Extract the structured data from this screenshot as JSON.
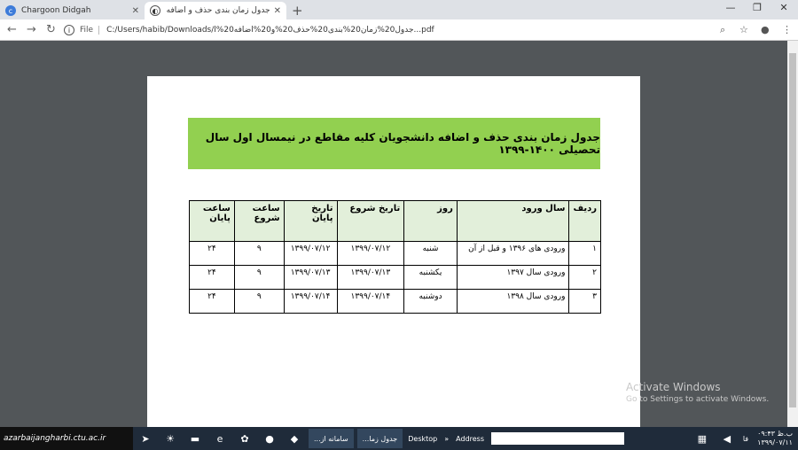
{
  "browser": {
    "tabs": [
      {
        "title": "Chargoon Didgah",
        "icon": "chargoon-icon"
      },
      {
        "title": "جدول زمان بندی حذف و اضافه ...pdf",
        "icon": "globe-icon"
      }
    ],
    "close_glyph": "✕",
    "new_tab_glyph": "+",
    "window_controls": {
      "minimize": "—",
      "maximize": "❐",
      "close": "✕"
    },
    "nav": {
      "back": "←",
      "forward": "→",
      "reload": "↻"
    },
    "address": {
      "scheme": "File",
      "url": "C:/Users/habib/Downloads/جدول20%زمان20%بندی20%حذف20%و20%اضافه20%ا...pdf"
    },
    "toolbar_icons": {
      "zoom": "⌕",
      "star": "☆",
      "account": "●",
      "menu": "⋮"
    }
  },
  "document": {
    "heading": "جدول زمان بندی حذف و اضافه دانشجویان کلیه مقاطع در نیمسال اول سال تحصیلی ۱۴۰۰-۱۳۹۹",
    "columns": [
      "ردیف",
      "سال ورود",
      "روز",
      "تاریخ شروع",
      "تاریخ پایان",
      "ساعت شروع",
      "ساعت پایان"
    ],
    "rows": [
      [
        "۱",
        "ورودی های ۱۳۹۶ و قبل از آن",
        "شنبه",
        "۱۳۹۹/۰۷/۱۲",
        "۱۳۹۹/۰۷/۱۲",
        "۹",
        "۲۴"
      ],
      [
        "۲",
        "ورودی سال ۱۳۹۷",
        "یکشنبه",
        "۱۳۹۹/۰۷/۱۳",
        "۱۳۹۹/۰۷/۱۳",
        "۹",
        "۲۴"
      ],
      [
        "۳",
        "ورودی سال ۱۳۹۸",
        "دوشنبه",
        "۱۳۹۹/۰۷/۱۴",
        "۱۳۹۹/۰۷/۱۴",
        "۹",
        "۲۴"
      ]
    ]
  },
  "watermark": {
    "line1": "Activate Windows",
    "line2": "Go to Settings to activate Windows."
  },
  "taskbar": {
    "logo": "azarbaijangharbi.ctu.ac.ir",
    "tasks": [
      "...سامانه از",
      "...جدول زما"
    ],
    "desktop_label": "Desktop",
    "chevron": "»",
    "address_label": "Address",
    "tray_lang": "فا",
    "clock_time": "۰۹:۴۳ ب.ظ",
    "clock_date": "۱۳۹۹/۰۷/۱۱"
  }
}
